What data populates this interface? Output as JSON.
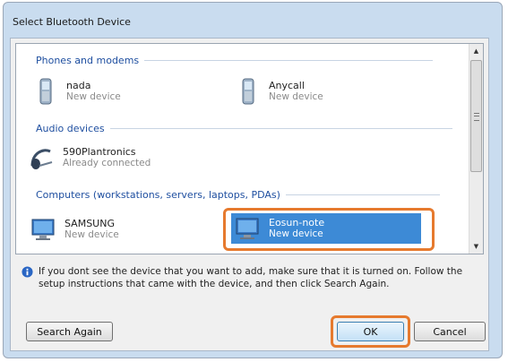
{
  "window": {
    "title": "Select Bluetooth Device"
  },
  "groups": [
    {
      "header": "Phones and modems",
      "items": [
        {
          "name": "nada",
          "status": "New device",
          "icon": "phone-icon"
        },
        {
          "name": "Anycall",
          "status": "New device",
          "icon": "phone-icon"
        }
      ]
    },
    {
      "header": "Audio devices",
      "items": [
        {
          "name": "590Plantronics",
          "status": "Already connected",
          "icon": "headset-icon"
        }
      ]
    },
    {
      "header": "Computers (workstations, servers, laptops, PDAs)",
      "items": [
        {
          "name": "SAMSUNG",
          "status": "New device",
          "icon": "computer-icon"
        },
        {
          "name": "Eosun-note",
          "status": "New device",
          "icon": "computer-icon",
          "selected": true
        }
      ]
    }
  ],
  "info_text": "If you dont see the device that you want to add, make sure that it is turned on. Follow the setup instructions that came with the device, and then click Search Again.",
  "buttons": {
    "search_again": "Search Again",
    "ok": "OK",
    "cancel": "Cancel"
  },
  "colors": {
    "highlight": "#e67a2e",
    "selection": "#3d8ad6",
    "group_header": "#1f4fa0"
  }
}
